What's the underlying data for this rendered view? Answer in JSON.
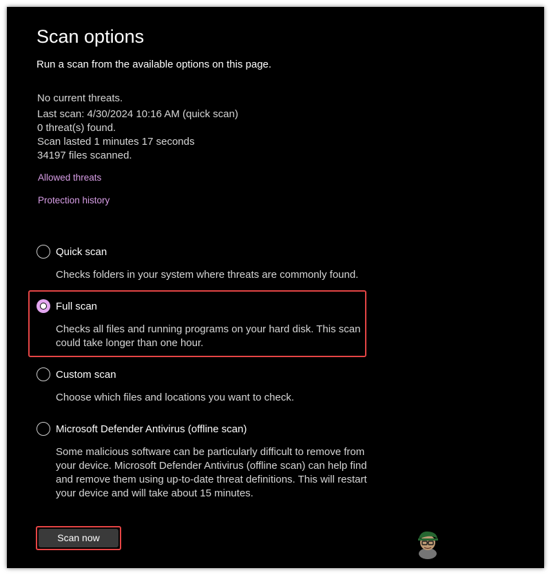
{
  "header": {
    "title": "Scan options",
    "subtitle": "Run a scan from the available options on this page."
  },
  "status": {
    "threat_state": "No current threats.",
    "last_scan": "Last scan: 4/30/2024 10:16 AM (quick scan)",
    "threats_found": "0 threat(s) found.",
    "duration": "Scan lasted 1 minutes 17 seconds",
    "files_scanned": "34197 files scanned."
  },
  "links": {
    "allowed_threats": "Allowed threats",
    "protection_history": "Protection history"
  },
  "options": [
    {
      "label": "Quick scan",
      "description": "Checks folders in your system where threats are commonly found.",
      "selected": false
    },
    {
      "label": "Full scan",
      "description": "Checks all files and running programs on your hard disk. This scan could take longer than one hour.",
      "selected": true
    },
    {
      "label": "Custom scan",
      "description": "Choose which files and locations you want to check.",
      "selected": false
    },
    {
      "label": "Microsoft Defender Antivirus (offline scan)",
      "description": "Some malicious software can be particularly difficult to remove from your device. Microsoft Defender Antivirus (offline scan) can help find and remove them using up-to-date threat definitions. This will restart your device and will take about 15 minutes.",
      "selected": false
    }
  ],
  "actions": {
    "scan_now": "Scan now"
  },
  "colors": {
    "background": "#000000",
    "accent": "#e3a6f0",
    "link": "#d89ee6",
    "highlight": "#e64545",
    "button": "#3a3a3a"
  },
  "watermark": {
    "icon": "appuals-mascot-icon"
  }
}
